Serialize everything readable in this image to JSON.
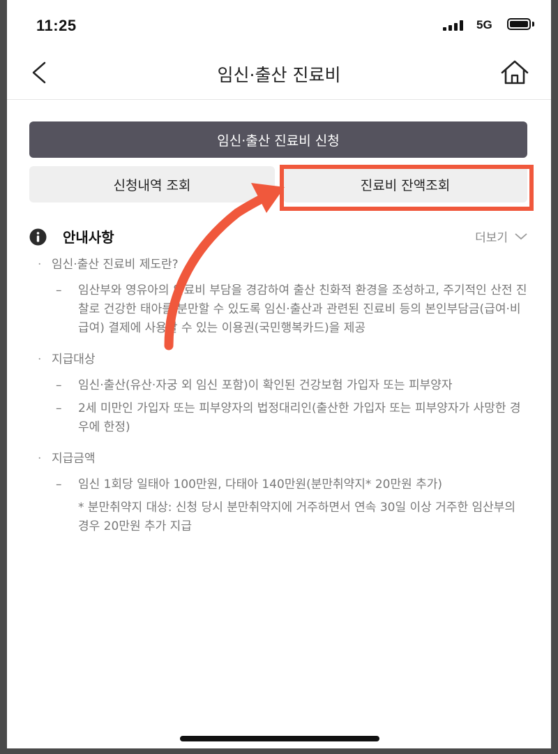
{
  "status_bar": {
    "time": "11:25",
    "network": "5G",
    "signal_bars": 4,
    "battery_level": 0.85
  },
  "header": {
    "title": "임신·출산 진료비",
    "back_icon": "chevron-left-icon",
    "home_icon": "home-icon"
  },
  "actions": {
    "primary_label": "임신·출산 진료비 신청",
    "history_label": "신청내역 조회",
    "balance_label": "진료비 잔액조회"
  },
  "notice": {
    "title": "안내사항",
    "more_label": "더보기",
    "sections": [
      {
        "title": "임신·출산 진료비 제도란?",
        "items": [
          "임산부와 영유아의 의료비 부담을 경감하여 출산 친화적 환경을 조성하고, 주기적인 산전 진찰로 건강한 태아를 분만할 수 있도록 임신·출산과 관련된 진료비 등의 본인부담금(급여·비급여) 결제에 사용할 수 있는 이용권(국민행복카드)을 제공"
        ]
      },
      {
        "title": "지급대상",
        "items": [
          "임신·출산(유산·자궁 외 임신 포함)이 확인된 건강보험 가입자 또는 피부양자",
          "2세 미만인 가입자 또는 피부양자의 법정대리인(출산한 가입자 또는 피부양자가 사망한 경우에 한정)"
        ]
      },
      {
        "title": "지급금액",
        "items": [
          "임신 1회당 일태아 100만원, 다태아 140만원(분만취약지* 20만원 추가)"
        ],
        "note": "* 분만취약지 대상: 신청 당시 분만취약지에 거주하면서 연속 30일 이상 거주한 임산부의 경우 20만원 추가 지급"
      }
    ]
  },
  "colors": {
    "highlight": "#f0583c",
    "primary_button": "#55535e",
    "secondary_button": "#efefef"
  }
}
